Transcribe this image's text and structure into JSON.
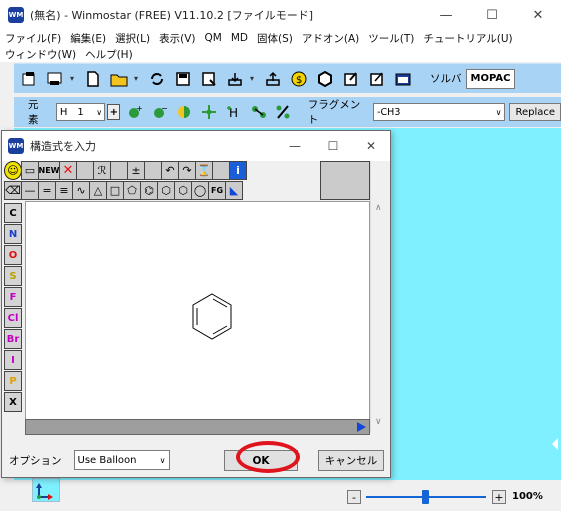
{
  "app": {
    "title": "(無名) - Winmostar (FREE) V11.10.2 [ファイルモード]",
    "icon_label": "WM",
    "window_controls": [
      "—",
      "☐",
      "✕"
    ]
  },
  "menu": {
    "row1": [
      "ファイル(F)",
      "編集(E)",
      "選択(L)",
      "表示(V)",
      "QM",
      "MD",
      "固体(S)",
      "アドオン(A)",
      "ツール(T)",
      "チュートリアル(U)"
    ],
    "row2": [
      "ウィンドウ(W)",
      "ヘルプ(H)"
    ]
  },
  "toolbar1": {
    "solver_label": "ソルバ",
    "solver_value": "MOPAC"
  },
  "toolbar2": {
    "element_label": "元素",
    "element_value": "H",
    "element_number": "1",
    "fragment_label": "フラグメント",
    "fragment_value": "-CH3",
    "replace_label": "Replace"
  },
  "dialog": {
    "title": "構造式を入力",
    "icon_label": "WM",
    "controls": [
      "—",
      "☐",
      "✕"
    ],
    "tools_row1": [
      {
        "name": "smile-tool",
        "glyph": "☺"
      },
      {
        "name": "rect-select-tool",
        "glyph": "▭"
      },
      {
        "name": "new-tool",
        "glyph": "NEW"
      },
      {
        "name": "delete-tool",
        "glyph": "✕"
      },
      {
        "name": "blank-1",
        "glyph": ""
      },
      {
        "name": "remove-r-tool",
        "glyph": "ℛ"
      },
      {
        "name": "blank-2",
        "glyph": ""
      },
      {
        "name": "charge-tool",
        "glyph": "±"
      },
      {
        "name": "blank-3",
        "glyph": ""
      },
      {
        "name": "undo-tool",
        "glyph": "↶"
      },
      {
        "name": "redo-tool",
        "glyph": "↷"
      },
      {
        "name": "clear-tool",
        "glyph": "⌛"
      },
      {
        "name": "blank-4",
        "glyph": ""
      },
      {
        "name": "info-tool",
        "glyph": "i"
      }
    ],
    "tools_row2": [
      {
        "name": "eraser-tool",
        "glyph": "⌫"
      },
      {
        "name": "single-bond-tool",
        "glyph": "—"
      },
      {
        "name": "double-bond-tool",
        "glyph": "="
      },
      {
        "name": "triple-bond-tool",
        "glyph": "≡"
      },
      {
        "name": "chain-tool",
        "glyph": "∿"
      },
      {
        "name": "ring3-tool",
        "glyph": "△"
      },
      {
        "name": "ring4-tool",
        "glyph": "□"
      },
      {
        "name": "ring5-tool",
        "glyph": "⬠"
      },
      {
        "name": "benzene-tool",
        "glyph": "⌬"
      },
      {
        "name": "ring6-tool",
        "glyph": "⬡"
      },
      {
        "name": "ring7-tool",
        "glyph": "⬡"
      },
      {
        "name": "ring8-tool",
        "glyph": "◯"
      },
      {
        "name": "fg-tool",
        "glyph": "FG"
      },
      {
        "name": "flip-tool",
        "glyph": "◣"
      }
    ],
    "elements": [
      {
        "symbol": "C",
        "color": "#000000"
      },
      {
        "symbol": "N",
        "color": "#1a3fd0"
      },
      {
        "symbol": "O",
        "color": "#e01010"
      },
      {
        "symbol": "S",
        "color": "#b8a300"
      },
      {
        "symbol": "F",
        "color": "#c400c4"
      },
      {
        "symbol": "Cl",
        "color": "#c400c4"
      },
      {
        "symbol": "Br",
        "color": "#c400c4"
      },
      {
        "symbol": "I",
        "color": "#c400c4"
      },
      {
        "symbol": "P",
        "color": "#e0a000"
      },
      {
        "symbol": "X",
        "color": "#000000"
      }
    ],
    "option_label": "オプション",
    "option_value": "Use Balloon",
    "ok_label": "OK",
    "cancel_label": "キャンセル"
  },
  "status": {
    "zoom_minus": "-",
    "zoom_plus": "+",
    "zoom_level": "100%"
  },
  "colors": {
    "toolbar_bg": "#a9d3f5",
    "viewport_bg": "#7ff0ff",
    "highlight": "#e0141c",
    "accent_blue": "#1466d4"
  }
}
